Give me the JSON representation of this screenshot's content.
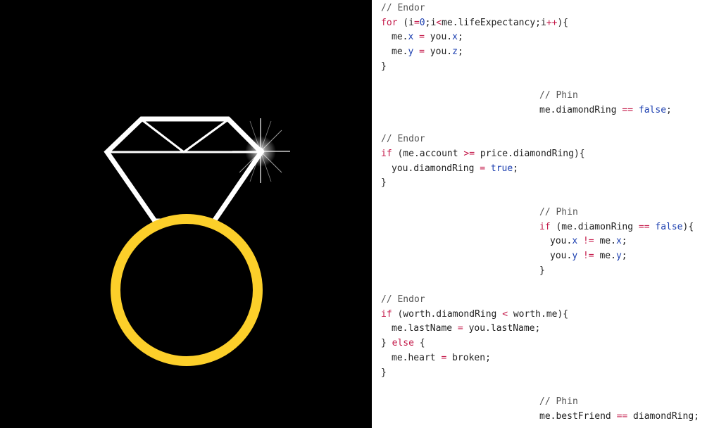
{
  "colors": {
    "art_background": "#000000",
    "diamond_stroke": "#ffffff",
    "band_stroke": "#fccf2a",
    "code_background": "#ffffff",
    "plain": "#222222",
    "keyword": "#c41a4a",
    "operator": "#c41a4a",
    "number": "#1c3fb0",
    "literal": "#1c3fb0",
    "property": "#1c3fb0",
    "comment": "#555555"
  },
  "icons": {
    "ring": "diamond-ring-icon",
    "sparkle": "sparkle-icon"
  },
  "code_lines": [
    {
      "indent": 0,
      "tokens": [
        [
          "// Endor",
          "comment"
        ]
      ]
    },
    {
      "indent": 0,
      "tokens": [
        [
          "for",
          "kw"
        ],
        [
          " (i",
          "plain"
        ],
        [
          "=",
          "op"
        ],
        [
          "0",
          "num"
        ],
        [
          ";i",
          "plain"
        ],
        [
          "<",
          "op"
        ],
        [
          "me.lifeExpectancy;i",
          "plain"
        ],
        [
          "++",
          "op"
        ],
        [
          "){",
          "plain"
        ]
      ]
    },
    {
      "indent": 1,
      "tokens": [
        [
          "me.",
          "plain"
        ],
        [
          "x",
          "prop"
        ],
        [
          " ",
          "plain"
        ],
        [
          "=",
          "op"
        ],
        [
          " you.",
          "plain"
        ],
        [
          "x",
          "prop"
        ],
        [
          ";",
          "plain"
        ]
      ]
    },
    {
      "indent": 1,
      "tokens": [
        [
          "me.",
          "plain"
        ],
        [
          "y",
          "prop"
        ],
        [
          " ",
          "plain"
        ],
        [
          "=",
          "op"
        ],
        [
          " you.",
          "plain"
        ],
        [
          "z",
          "prop"
        ],
        [
          ";",
          "plain"
        ]
      ]
    },
    {
      "indent": 0,
      "tokens": [
        [
          "}",
          "plain"
        ]
      ]
    },
    {
      "indent": 0,
      "tokens": []
    },
    {
      "indent": 15,
      "tokens": [
        [
          "// Phin",
          "comment"
        ]
      ]
    },
    {
      "indent": 15,
      "tokens": [
        [
          "me.diamondRing ",
          "plain"
        ],
        [
          "==",
          "op"
        ],
        [
          " ",
          "plain"
        ],
        [
          "false",
          "lit"
        ],
        [
          ";",
          "plain"
        ]
      ]
    },
    {
      "indent": 0,
      "tokens": []
    },
    {
      "indent": 0,
      "tokens": [
        [
          "// Endor",
          "comment"
        ]
      ]
    },
    {
      "indent": 0,
      "tokens": [
        [
          "if",
          "kw"
        ],
        [
          " (me.account ",
          "plain"
        ],
        [
          ">=",
          "op"
        ],
        [
          " price.diamondRing){",
          "plain"
        ]
      ]
    },
    {
      "indent": 1,
      "tokens": [
        [
          "you.diamondRing ",
          "plain"
        ],
        [
          "=",
          "op"
        ],
        [
          " ",
          "plain"
        ],
        [
          "true",
          "lit"
        ],
        [
          ";",
          "plain"
        ]
      ]
    },
    {
      "indent": 0,
      "tokens": [
        [
          "}",
          "plain"
        ]
      ]
    },
    {
      "indent": 0,
      "tokens": []
    },
    {
      "indent": 15,
      "tokens": [
        [
          "// Phin",
          "comment"
        ]
      ]
    },
    {
      "indent": 15,
      "tokens": [
        [
          "if",
          "kw"
        ],
        [
          " (me.diamonRing ",
          "plain"
        ],
        [
          "==",
          "op"
        ],
        [
          " ",
          "plain"
        ],
        [
          "false",
          "lit"
        ],
        [
          "){",
          "plain"
        ]
      ]
    },
    {
      "indent": 16,
      "tokens": [
        [
          "you.",
          "plain"
        ],
        [
          "x",
          "prop"
        ],
        [
          " ",
          "plain"
        ],
        [
          "!=",
          "op"
        ],
        [
          " me.",
          "plain"
        ],
        [
          "x",
          "prop"
        ],
        [
          ";",
          "plain"
        ]
      ]
    },
    {
      "indent": 16,
      "tokens": [
        [
          "you.",
          "plain"
        ],
        [
          "y",
          "prop"
        ],
        [
          " ",
          "plain"
        ],
        [
          "!=",
          "op"
        ],
        [
          " me.",
          "plain"
        ],
        [
          "y",
          "prop"
        ],
        [
          ";",
          "plain"
        ]
      ]
    },
    {
      "indent": 15,
      "tokens": [
        [
          "}",
          "plain"
        ]
      ]
    },
    {
      "indent": 0,
      "tokens": []
    },
    {
      "indent": 0,
      "tokens": [
        [
          "// Endor",
          "comment"
        ]
      ]
    },
    {
      "indent": 0,
      "tokens": [
        [
          "if",
          "kw"
        ],
        [
          " (worth.diamondRing ",
          "plain"
        ],
        [
          "<",
          "op"
        ],
        [
          " worth.me){",
          "plain"
        ]
      ]
    },
    {
      "indent": 1,
      "tokens": [
        [
          "me.lastName ",
          "plain"
        ],
        [
          "=",
          "op"
        ],
        [
          " you.lastName;",
          "plain"
        ]
      ]
    },
    {
      "indent": 0,
      "tokens": [
        [
          "} ",
          "plain"
        ],
        [
          "else",
          "kw"
        ],
        [
          " {",
          "plain"
        ]
      ]
    },
    {
      "indent": 1,
      "tokens": [
        [
          "me.heart ",
          "plain"
        ],
        [
          "=",
          "op"
        ],
        [
          " broken;",
          "plain"
        ]
      ]
    },
    {
      "indent": 0,
      "tokens": [
        [
          "}",
          "plain"
        ]
      ]
    },
    {
      "indent": 0,
      "tokens": []
    },
    {
      "indent": 15,
      "tokens": [
        [
          "// Phin",
          "comment"
        ]
      ]
    },
    {
      "indent": 15,
      "tokens": [
        [
          "me.bestFriend ",
          "plain"
        ],
        [
          "==",
          "op"
        ],
        [
          " diamondRing;",
          "plain"
        ]
      ]
    }
  ]
}
